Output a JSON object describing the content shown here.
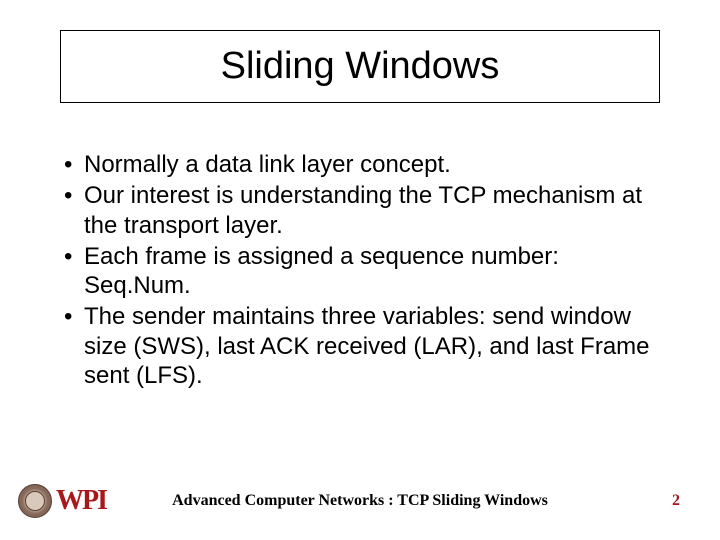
{
  "title": "Sliding Windows",
  "bullets": [
    "Normally a data link layer concept.",
    "Our interest is understanding the TCP mechanism at the transport layer.",
    "Each frame is assigned a sequence number: Seq.Num.",
    "The sender maintains three variables: send window size (SWS), last ACK received (LAR), and last Frame sent (LFS)."
  ],
  "footer": {
    "course": "Advanced Computer Networks : TCP Sliding Windows",
    "page": "2",
    "logo_text": "WPI"
  }
}
